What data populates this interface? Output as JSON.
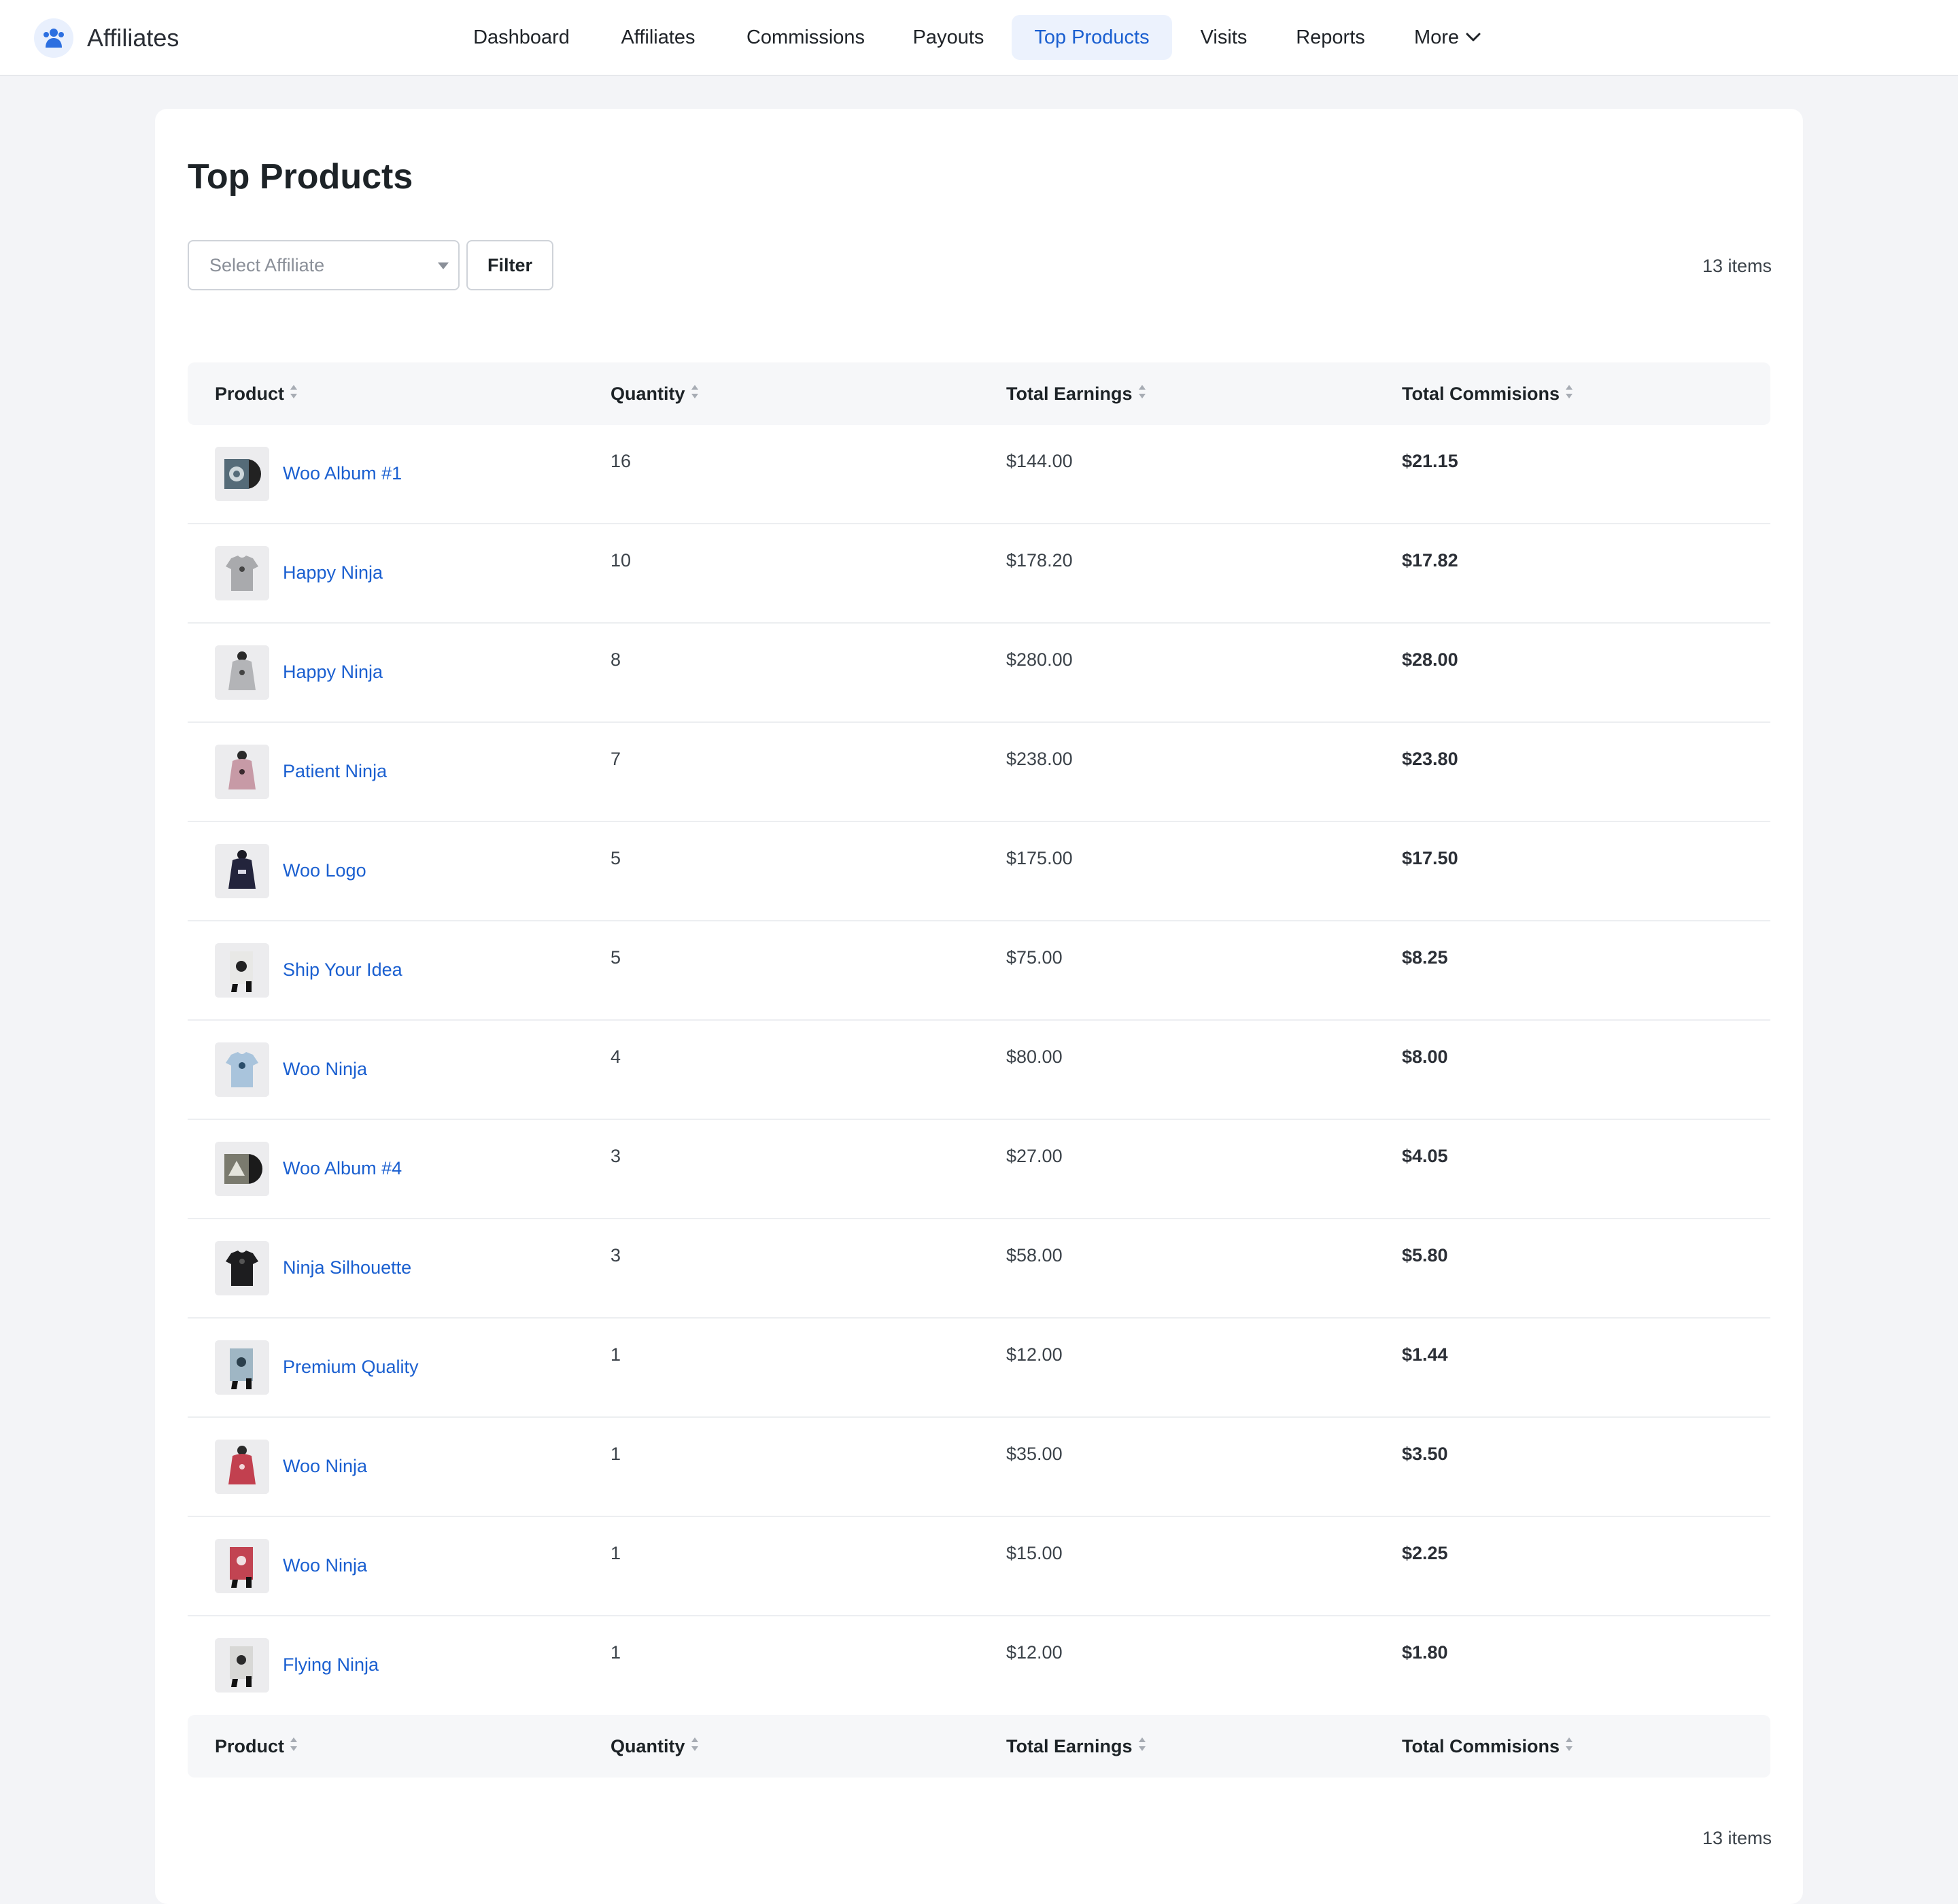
{
  "brand": {
    "name": "Affiliates"
  },
  "nav": [
    {
      "label": "Dashboard",
      "active": false
    },
    {
      "label": "Affiliates",
      "active": false
    },
    {
      "label": "Commissions",
      "active": false
    },
    {
      "label": "Payouts",
      "active": false
    },
    {
      "label": "Top Products",
      "active": true
    },
    {
      "label": "Visits",
      "active": false
    },
    {
      "label": "Reports",
      "active": false
    },
    {
      "label": "More",
      "active": false
    }
  ],
  "page": {
    "title": "Top Products",
    "filter": {
      "select_placeholder": "Select Affiliate",
      "button_label": "Filter"
    },
    "items_count": "13 items"
  },
  "table": {
    "columns": [
      "Product",
      "Quantity",
      "Total Earnings",
      "Total Commisions"
    ],
    "rows": [
      {
        "product": "Woo Album #1",
        "quantity": "16",
        "earnings": "$144.00",
        "commission": "$21.15",
        "thumb": "album"
      },
      {
        "product": "Happy Ninja",
        "quantity": "10",
        "earnings": "$178.20",
        "commission": "$17.82",
        "thumb": "tshirt-grey"
      },
      {
        "product": "Happy Ninja",
        "quantity": "8",
        "earnings": "$280.00",
        "commission": "$28.00",
        "thumb": "hoodie-grey"
      },
      {
        "product": "Patient Ninja",
        "quantity": "7",
        "earnings": "$238.00",
        "commission": "$23.80",
        "thumb": "hoodie-pink"
      },
      {
        "product": "Woo Logo",
        "quantity": "5",
        "earnings": "$175.00",
        "commission": "$17.50",
        "thumb": "hoodie-navy"
      },
      {
        "product": "Ship Your Idea",
        "quantity": "5",
        "earnings": "$75.00",
        "commission": "$8.25",
        "thumb": "poster-light"
      },
      {
        "product": "Woo Ninja",
        "quantity": "4",
        "earnings": "$80.00",
        "commission": "$8.00",
        "thumb": "tshirt-blue"
      },
      {
        "product": "Woo Album #4",
        "quantity": "3",
        "earnings": "$27.00",
        "commission": "$4.05",
        "thumb": "album-dark"
      },
      {
        "product": "Ninja Silhouette",
        "quantity": "3",
        "earnings": "$58.00",
        "commission": "$5.80",
        "thumb": "tshirt-black"
      },
      {
        "product": "Premium Quality",
        "quantity": "1",
        "earnings": "$12.00",
        "commission": "$1.44",
        "thumb": "poster-blue"
      },
      {
        "product": "Woo Ninja",
        "quantity": "1",
        "earnings": "$35.00",
        "commission": "$3.50",
        "thumb": "hoodie-red"
      },
      {
        "product": "Woo Ninja",
        "quantity": "1",
        "earnings": "$15.00",
        "commission": "$2.25",
        "thumb": "poster-red"
      },
      {
        "product": "Flying Ninja",
        "quantity": "1",
        "earnings": "$12.00",
        "commission": "$1.80",
        "thumb": "poster-grey"
      }
    ]
  },
  "colors": {
    "accent": "#1a5fd0",
    "active_tab_bg": "#ecf2fd",
    "page_bg": "#f3f4f7",
    "header_row_bg": "#f6f7f9"
  },
  "icons": {
    "brand": "affiliates-logo-icon",
    "more": "chevron-down-icon",
    "sort": "sort-icon",
    "select": "caret-down-icon"
  }
}
